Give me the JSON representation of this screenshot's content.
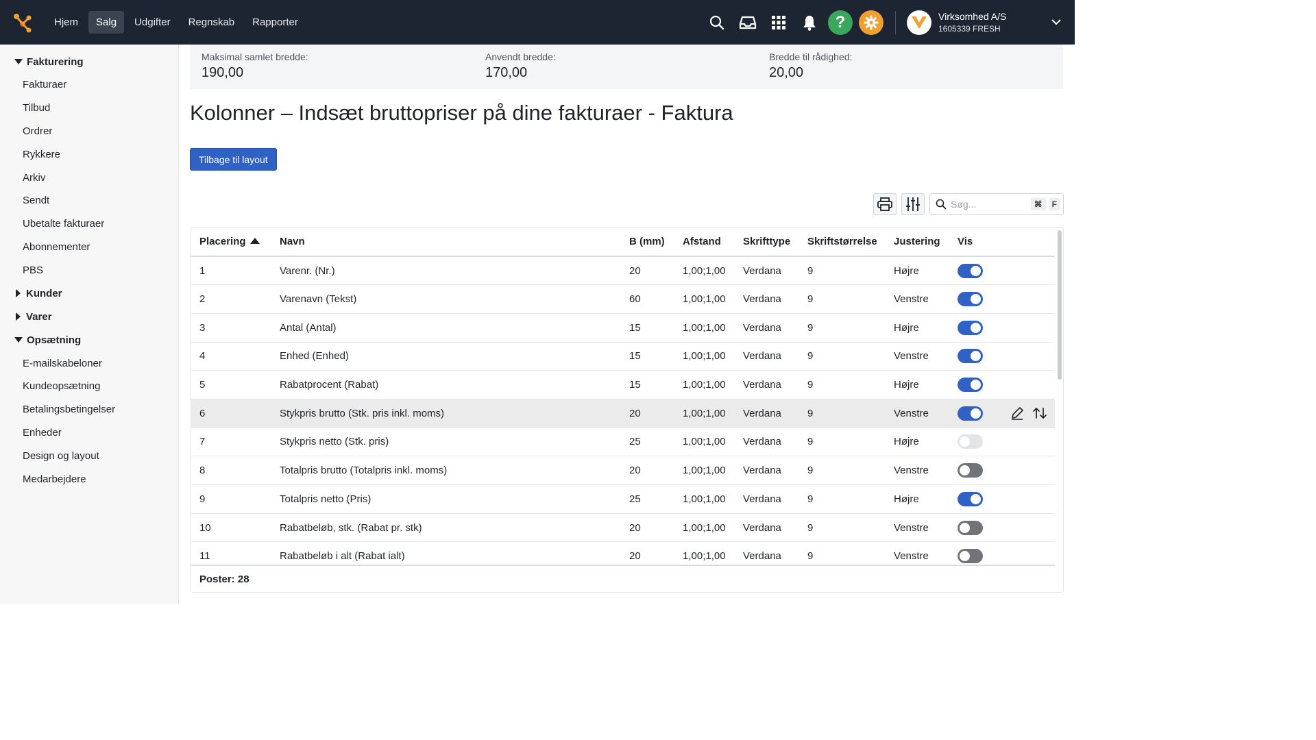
{
  "nav": {
    "items": [
      "Hjem",
      "Salg",
      "Udgifter",
      "Regnskab",
      "Rapporter"
    ],
    "active": "Salg"
  },
  "company": {
    "name": "Virksomhed A/S",
    "sub": "1605339 FRESH"
  },
  "icons": {
    "help": "?",
    "help_color": "#3aa75d",
    "gear_color": "#f0a030"
  },
  "sidebar": {
    "groups": [
      {
        "label": "Fakturering",
        "expanded": true,
        "items": [
          "Fakturaer",
          "Tilbud",
          "Ordrer",
          "Rykkere",
          "Arkiv",
          "Sendt",
          "Ubetalte fakturaer",
          "Abonnementer",
          "PBS"
        ]
      },
      {
        "label": "Kunder",
        "expanded": false,
        "items": []
      },
      {
        "label": "Varer",
        "expanded": false,
        "items": []
      },
      {
        "label": "Opsætning",
        "expanded": true,
        "items": [
          "E-mailskabeloner",
          "Kundeopsætning",
          "Betalingsbetingelser",
          "Enheder",
          "Design og layout",
          "Medarbejdere"
        ]
      }
    ]
  },
  "widths": {
    "max_label": "Maksimal samlet bredde:",
    "max_value": "190,00",
    "used_label": "Anvendt bredde:",
    "used_value": "170,00",
    "avail_label": "Bredde til rådighed:",
    "avail_value": "20,00"
  },
  "page": {
    "title": "Kolonner – Indsæt bruttopriser på dine fakturaer - Faktura",
    "back_button": "Tilbage til layout"
  },
  "search": {
    "placeholder": "Søg...",
    "kbd1": "⌘",
    "kbd2": "F"
  },
  "table": {
    "headers": [
      "Placering",
      "Navn",
      "B (mm)",
      "Afstand",
      "Skrifttype",
      "Skriftstørrelse",
      "Justering",
      "Vis"
    ],
    "rows": [
      {
        "pos": "1",
        "name": "Varenr. (Nr.)",
        "b": "20",
        "afstand": "1,00;1,00",
        "font": "Verdana",
        "size": "9",
        "just": "Højre",
        "vis": "on"
      },
      {
        "pos": "2",
        "name": "Varenavn (Tekst)",
        "b": "60",
        "afstand": "1,00;1,00",
        "font": "Verdana",
        "size": "9",
        "just": "Venstre",
        "vis": "on"
      },
      {
        "pos": "3",
        "name": "Antal (Antal)",
        "b": "15",
        "afstand": "1,00;1,00",
        "font": "Verdana",
        "size": "9",
        "just": "Højre",
        "vis": "on"
      },
      {
        "pos": "4",
        "name": "Enhed (Enhed)",
        "b": "15",
        "afstand": "1,00;1,00",
        "font": "Verdana",
        "size": "9",
        "just": "Venstre",
        "vis": "on"
      },
      {
        "pos": "5",
        "name": "Rabatprocent (Rabat)",
        "b": "15",
        "afstand": "1,00;1,00",
        "font": "Verdana",
        "size": "9",
        "just": "Højre",
        "vis": "on"
      },
      {
        "pos": "6",
        "name": "Stykpris brutto (Stk. pris inkl. moms)",
        "b": "20",
        "afstand": "1,00;1,00",
        "font": "Verdana",
        "size": "9",
        "just": "Venstre",
        "vis": "on",
        "hover": true
      },
      {
        "pos": "7",
        "name": "Stykpris netto (Stk. pris)",
        "b": "25",
        "afstand": "1,00;1,00",
        "font": "Verdana",
        "size": "9",
        "just": "Højre",
        "vis": "dim"
      },
      {
        "pos": "8",
        "name": "Totalpris brutto (Totalpris inkl. moms)",
        "b": "20",
        "afstand": "1,00;1,00",
        "font": "Verdana",
        "size": "9",
        "just": "Venstre",
        "vis": "off"
      },
      {
        "pos": "9",
        "name": "Totalpris netto (Pris)",
        "b": "25",
        "afstand": "1,00;1,00",
        "font": "Verdana",
        "size": "9",
        "just": "Højre",
        "vis": "on"
      },
      {
        "pos": "10",
        "name": "Rabatbeløb, stk. (Rabat pr. stk)",
        "b": "20",
        "afstand": "1,00;1,00",
        "font": "Verdana",
        "size": "9",
        "just": "Venstre",
        "vis": "off"
      },
      {
        "pos": "11",
        "name": "Rabatbeløb i alt (Rabat ialt)",
        "b": "20",
        "afstand": "1,00;1,00",
        "font": "Verdana",
        "size": "9",
        "just": "Venstre",
        "vis": "off"
      }
    ],
    "footer": "Poster: 28"
  }
}
